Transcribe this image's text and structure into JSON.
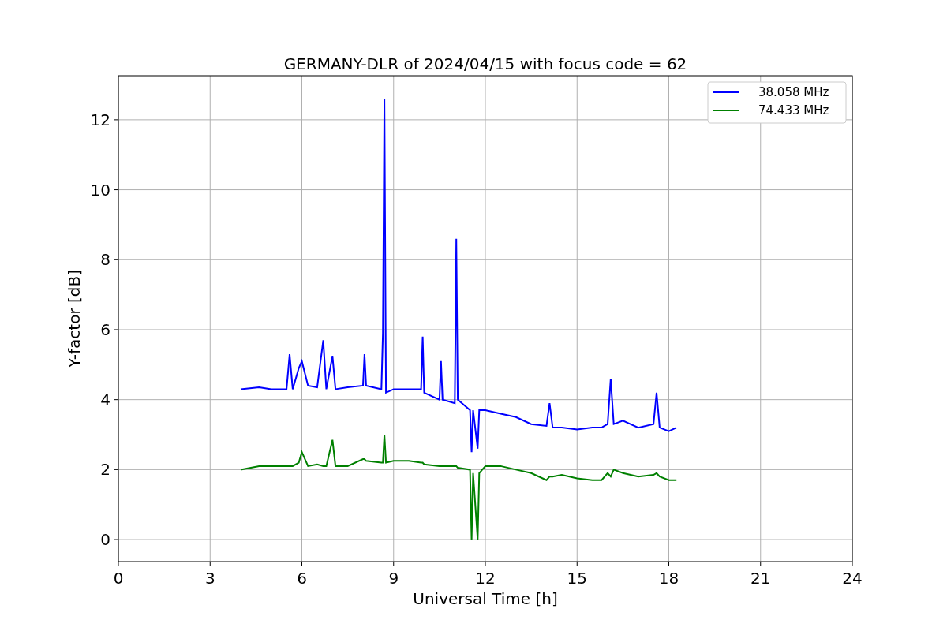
{
  "figure": {
    "chart_data": {
      "type": "line",
      "title": "GERMANY-DLR of 2024/04/15 with focus code = 62",
      "xlabel": "Universal Time [h]",
      "ylabel": "Y-factor [dB]",
      "x": [
        4.0,
        4.6,
        5.0,
        5.5,
        5.6,
        5.7,
        5.9,
        6.0,
        6.2,
        6.5,
        6.7,
        6.8,
        7.0,
        7.1,
        7.5,
        8.0,
        8.05,
        8.1,
        8.6,
        8.65,
        8.7,
        8.75,
        9.0,
        9.5,
        9.9,
        9.95,
        10.0,
        10.5,
        10.55,
        10.6,
        11.0,
        11.05,
        11.1,
        11.5,
        11.55,
        11.6,
        11.75,
        11.8,
        12.0,
        12.5,
        13.0,
        13.5,
        14.0,
        14.1,
        14.2,
        14.5,
        15.0,
        15.5,
        15.8,
        16.0,
        16.1,
        16.2,
        16.5,
        17.0,
        17.5,
        17.6,
        17.7,
        18.0,
        18.25
      ],
      "series": [
        {
          "name": "38.058 MHz",
          "color": "#0000ff",
          "values": [
            4.3,
            4.35,
            4.3,
            4.3,
            5.3,
            4.3,
            4.9,
            5.1,
            4.4,
            4.35,
            5.7,
            4.3,
            5.25,
            4.3,
            4.35,
            4.4,
            5.3,
            4.4,
            4.3,
            5.9,
            12.6,
            4.2,
            4.3,
            4.3,
            4.3,
            5.8,
            4.2,
            4.0,
            5.1,
            4.0,
            3.9,
            8.6,
            4.0,
            3.7,
            2.5,
            3.7,
            2.6,
            3.7,
            3.7,
            3.6,
            3.5,
            3.3,
            3.25,
            3.9,
            3.2,
            3.2,
            3.15,
            3.2,
            3.2,
            3.3,
            4.6,
            3.3,
            3.4,
            3.2,
            3.3,
            4.2,
            3.2,
            3.1,
            3.2
          ]
        },
        {
          "name": "74.433 MHz",
          "color": "#008000",
          "values": [
            2.0,
            2.1,
            2.1,
            2.1,
            2.1,
            2.1,
            2.2,
            2.5,
            2.1,
            2.15,
            2.1,
            2.1,
            2.85,
            2.1,
            2.1,
            2.3,
            2.3,
            2.25,
            2.2,
            2.2,
            3.0,
            2.2,
            2.25,
            2.25,
            2.2,
            2.2,
            2.15,
            2.1,
            2.1,
            2.1,
            2.1,
            2.1,
            2.05,
            2.0,
            0.0,
            1.9,
            0.0,
            1.9,
            2.1,
            2.1,
            2.0,
            1.9,
            1.7,
            1.8,
            1.8,
            1.85,
            1.75,
            1.7,
            1.7,
            1.9,
            1.8,
            2.0,
            1.9,
            1.8,
            1.85,
            1.9,
            1.8,
            1.7,
            1.7
          ]
        }
      ],
      "xlim": [
        0,
        24
      ],
      "ylim": [
        -0.63,
        13.26
      ],
      "xticks": [
        0,
        3,
        6,
        9,
        12,
        15,
        18,
        21,
        24
      ],
      "yticks": [
        0,
        2,
        4,
        6,
        8,
        10,
        12
      ],
      "grid": true,
      "legend": "upper right"
    }
  }
}
